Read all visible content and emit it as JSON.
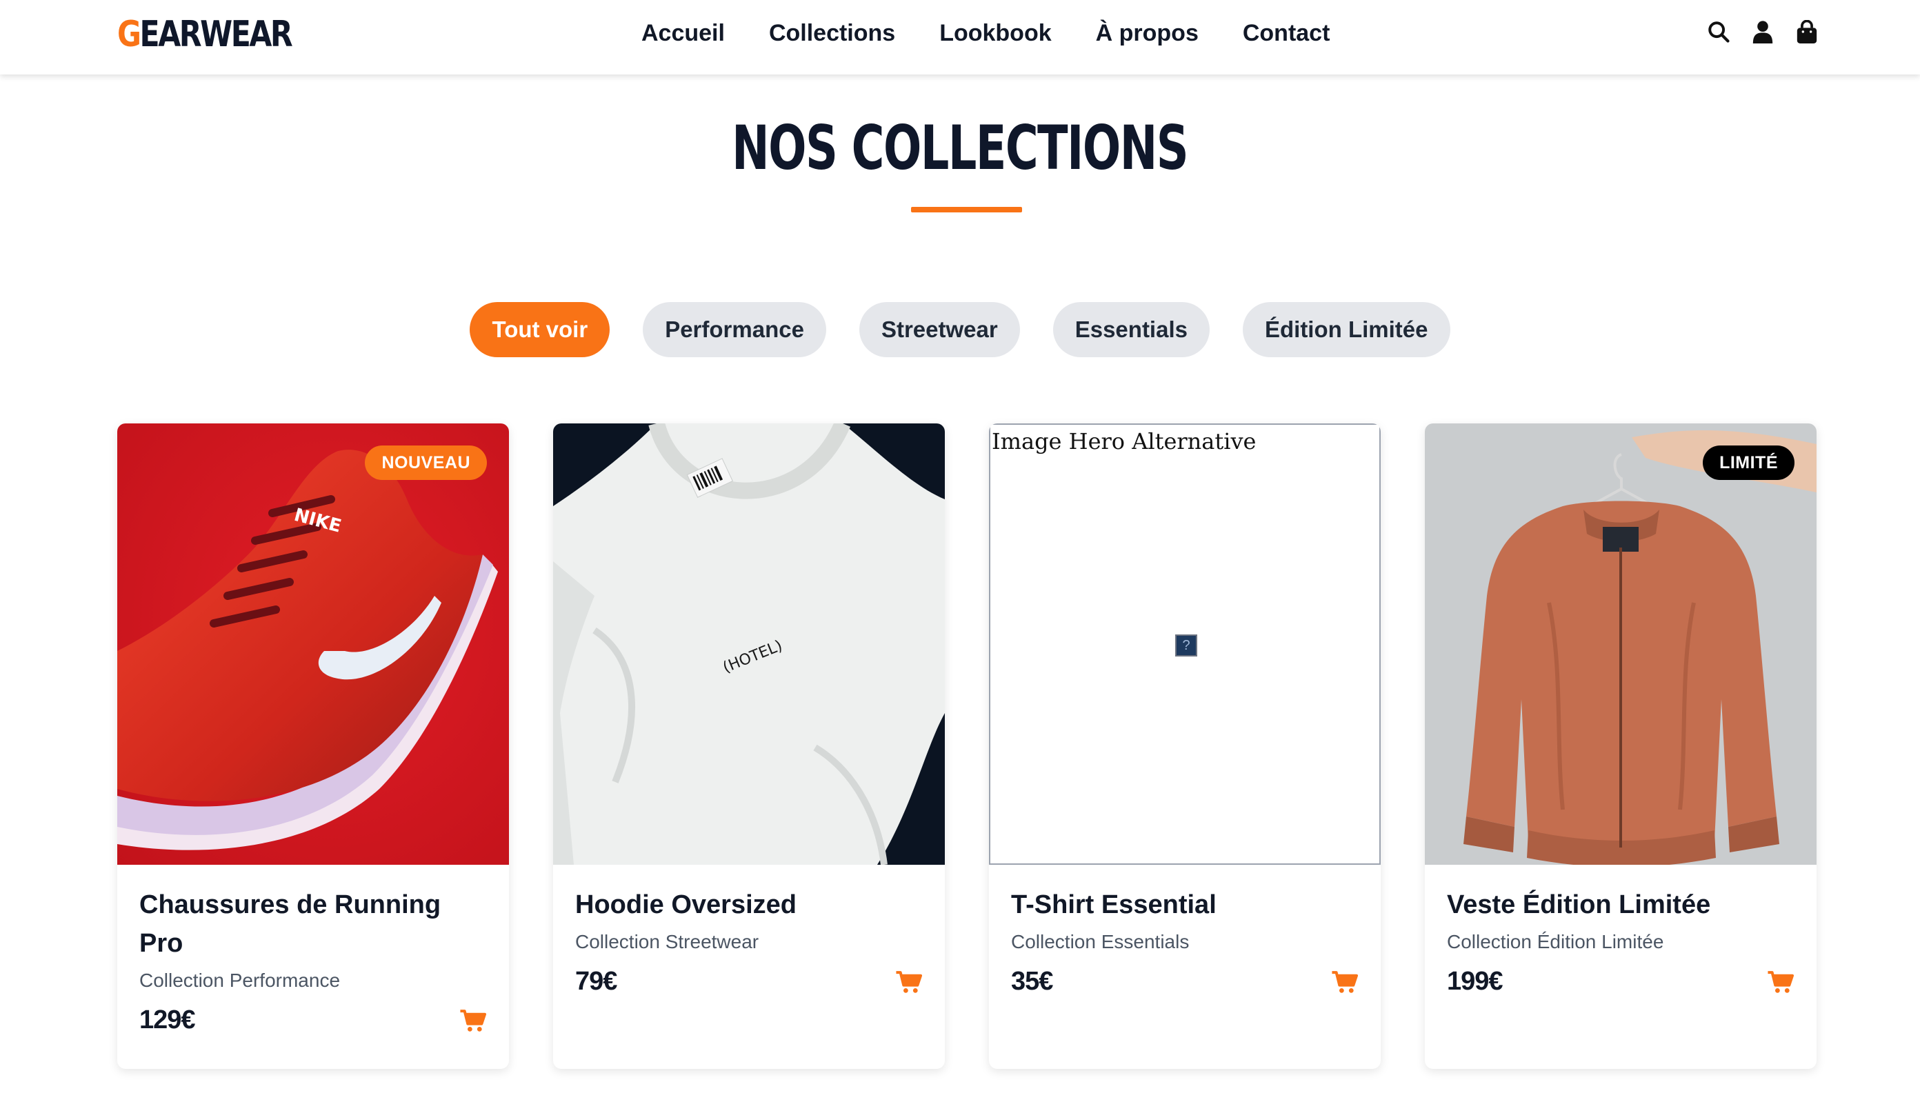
{
  "brand": {
    "first_letter": "G",
    "rest": "EARWEAR",
    "accent_color": "#f97316"
  },
  "nav": {
    "items": [
      {
        "label": "Accueil"
      },
      {
        "label": "Collections"
      },
      {
        "label": "Lookbook"
      },
      {
        "label": "À propos"
      },
      {
        "label": "Contact"
      }
    ]
  },
  "header_icons": [
    "search-icon",
    "user-icon",
    "shopping-bag-icon"
  ],
  "page": {
    "title": "NOS COLLECTIONS"
  },
  "filters": [
    {
      "label": "Tout voir",
      "active": true
    },
    {
      "label": "Performance",
      "active": false
    },
    {
      "label": "Streetwear",
      "active": false
    },
    {
      "label": "Essentials",
      "active": false
    },
    {
      "label": "Édition Limitée",
      "active": false
    }
  ],
  "products": [
    {
      "name": "Chaussures de Running Pro",
      "collection": "Collection Performance",
      "price": "129€",
      "badge": "NOUVEAU",
      "image": "red-running-shoe"
    },
    {
      "name": "Hoodie Oversized",
      "collection": "Collection Streetwear",
      "price": "79€",
      "badge": "",
      "image": "white-tshirt",
      "shirt_print": "(HOTEL)"
    },
    {
      "name": "T-Shirt Essential",
      "collection": "Collection Essentials",
      "price": "35€",
      "badge": "",
      "image_alt": "Image Hero Alternative",
      "image": "broken-image"
    },
    {
      "name": "Veste Édition Limitée",
      "collection": "Collection Édition Limitée",
      "price": "199€",
      "badge": "LIMITÉ",
      "image": "orange-bomber-jacket"
    }
  ],
  "colors": {
    "accent": "#f97316",
    "chip_bg": "#e5e7eb",
    "text": "#111827"
  }
}
